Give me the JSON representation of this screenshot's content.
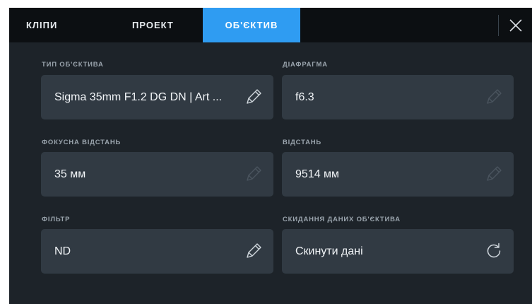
{
  "tabs": {
    "clips": "КЛІПИ",
    "project": "ПРОЕКТ",
    "lens": "ОБ'ЄКТИВ"
  },
  "fields": {
    "lens_type": {
      "label": "ТИП ОБ'ЄКТИВА",
      "value": "Sigma 35mm F1.2 DG DN | Art ...",
      "icon": "pencil-icon"
    },
    "aperture": {
      "label": "ДІАФРАГМА",
      "value": "f6.3",
      "icon": "pencil-icon-dimmed"
    },
    "focal_length": {
      "label": "ФОКУСНА ВІДСТАНЬ",
      "value": "35 мм",
      "icon": "pencil-icon-dimmed"
    },
    "distance": {
      "label": "ВІДСТАНЬ",
      "value": "9514 мм",
      "icon": "pencil-icon-dimmed"
    },
    "filter": {
      "label": "ФІЛЬТР",
      "value": "ND",
      "icon": "pencil-icon"
    },
    "reset": {
      "label": "СКИДАННЯ ДАНИХ ОБ'ЄКТИВА",
      "value": "Скинути дані",
      "icon": "reset-icon"
    }
  },
  "colors": {
    "active_tab": "#2f9cf2",
    "background": "#1d2329",
    "field_background": "#313a43",
    "tabbar_background": "#0c0f12"
  }
}
